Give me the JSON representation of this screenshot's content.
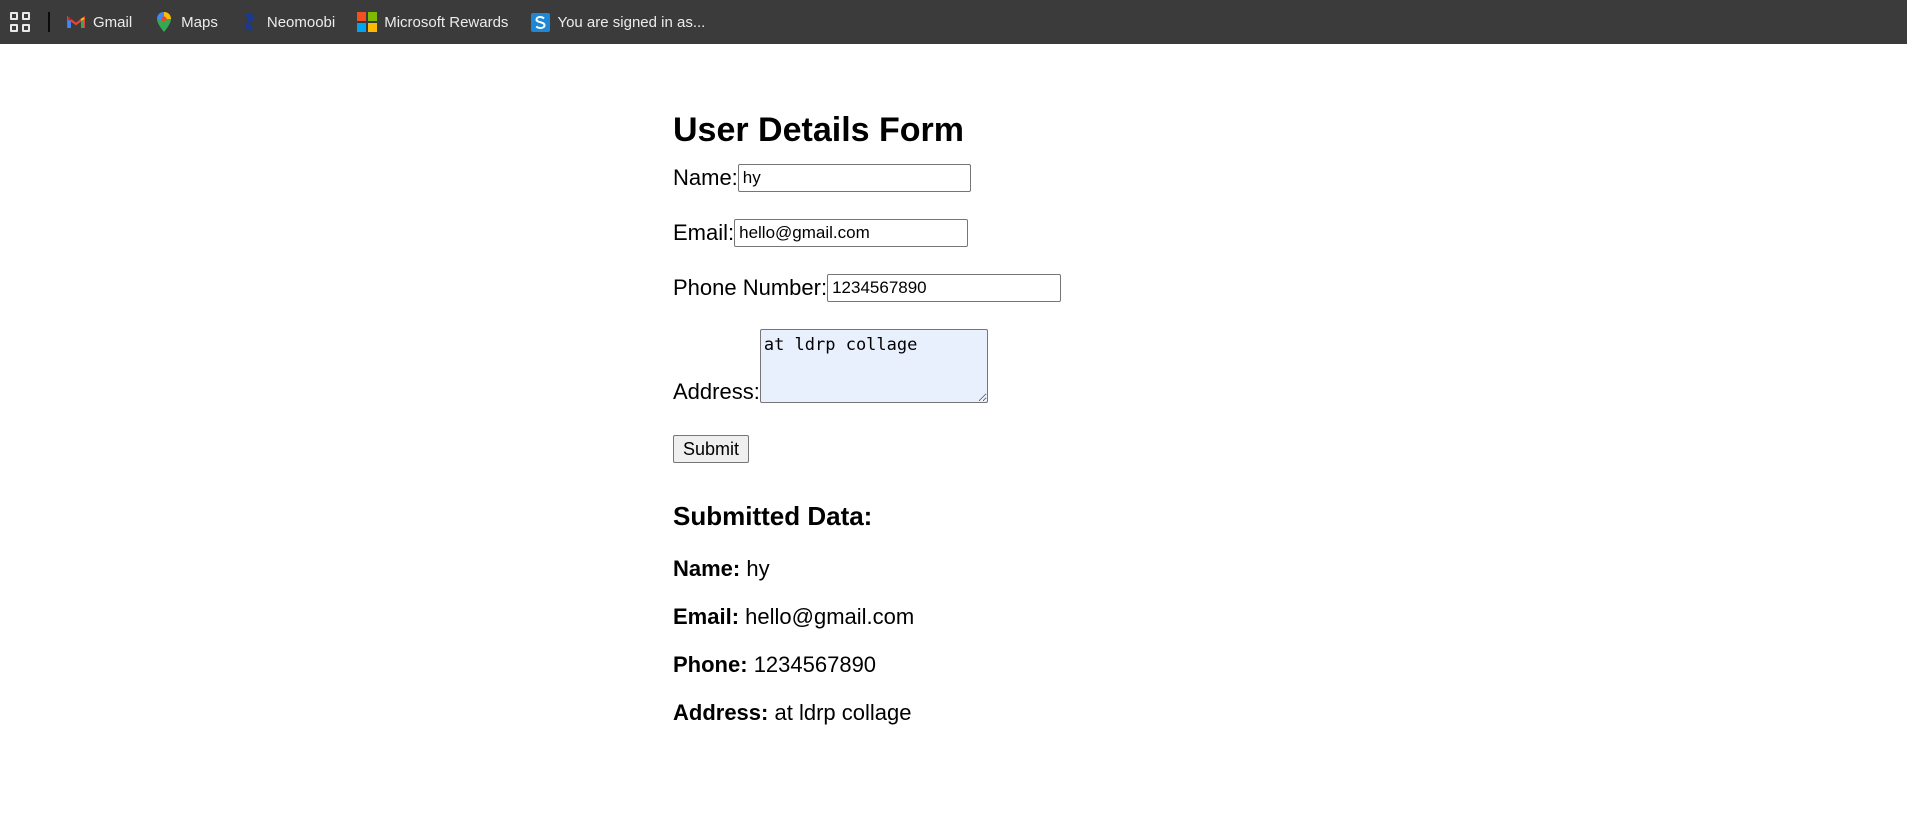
{
  "bookmarks": [
    {
      "label": "Gmail",
      "icon": "gmail-icon"
    },
    {
      "label": "Maps",
      "icon": "maps-icon"
    },
    {
      "label": "Neomoobi",
      "icon": "neomoobi-icon"
    },
    {
      "label": "Microsoft Rewards",
      "icon": "microsoft-icon"
    },
    {
      "label": "You are signed in as...",
      "icon": "s-icon"
    }
  ],
  "form": {
    "title": "User Details Form",
    "name_label": "Name:",
    "name_value": "hy",
    "email_label": "Email:",
    "email_value": "hello@gmail.com",
    "phone_label": "Phone Number:",
    "phone_value": "1234567890",
    "address_label": "Address:",
    "address_value": "at ldrp collage",
    "submit_label": "Submit"
  },
  "submitted": {
    "title": "Submitted Data:",
    "name_label": "Name:",
    "name_value": "hy",
    "email_label": "Email:",
    "email_value": "hello@gmail.com",
    "phone_label": "Phone:",
    "phone_value": "1234567890",
    "address_label": "Address:",
    "address_value": "at ldrp collage"
  },
  "colors": {
    "bookmarks_bar": "#3b3b3b",
    "autofill_bg": "#e8f0fe"
  }
}
